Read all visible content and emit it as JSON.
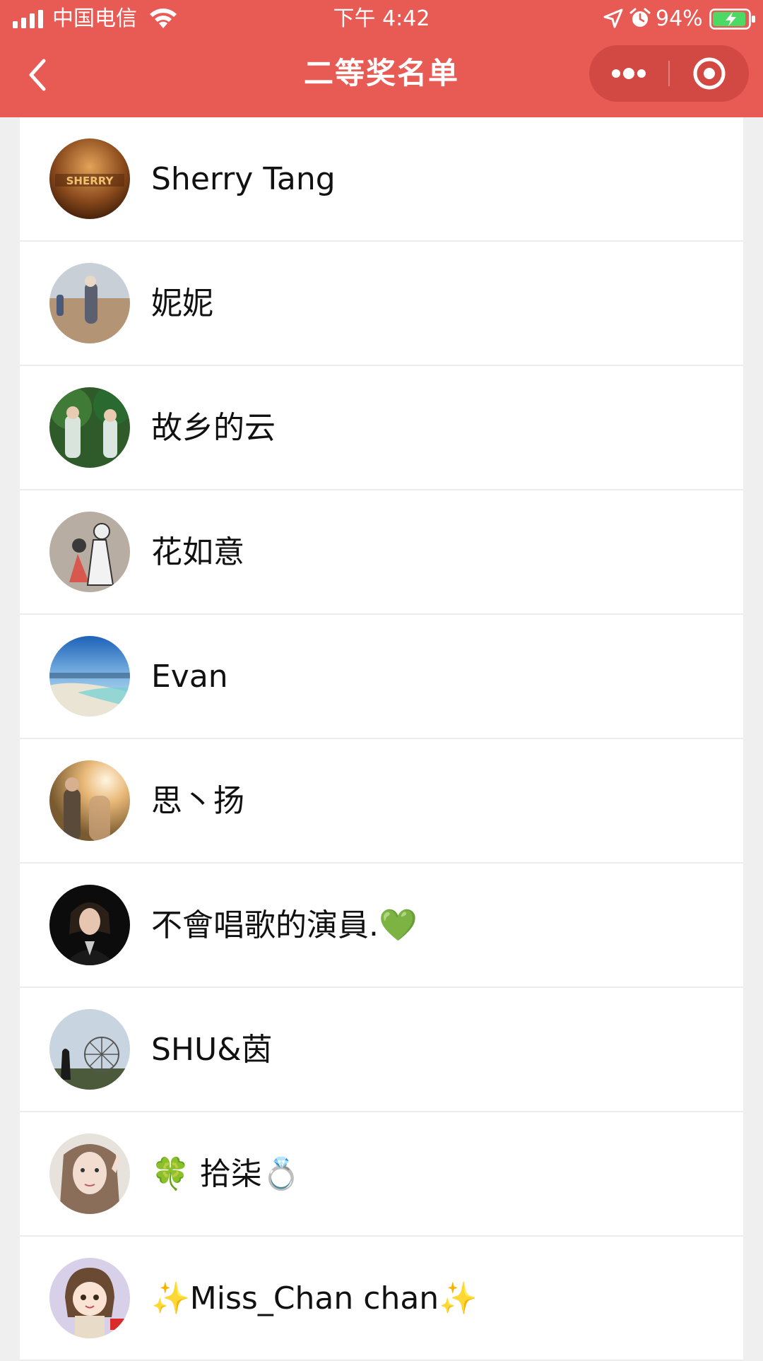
{
  "status_bar": {
    "carrier": "中国电信",
    "time": "下午 4:42",
    "battery_percent": "94%",
    "battery_level": 0.94
  },
  "nav": {
    "title": "二等奖名单",
    "back_icon": "chevron-left-icon",
    "more_icon": "more-dots-icon",
    "close_icon": "target-circle-icon"
  },
  "winners": [
    {
      "name": "Sherry Tang"
    },
    {
      "name": "妮妮"
    },
    {
      "name": "故乡的云"
    },
    {
      "name": "花如意"
    },
    {
      "name": "Evan"
    },
    {
      "name": "思丶扬"
    },
    {
      "name": "不會唱歌的演員.💚"
    },
    {
      "name": "SHU&茵"
    },
    {
      "name": "🍀 拾柒💍"
    },
    {
      "name": "✨Miss_Chan chan✨"
    }
  ],
  "colors": {
    "header": "#e85a54",
    "capsule": "#d24843",
    "background": "#efefef",
    "row": "#ffffff"
  }
}
